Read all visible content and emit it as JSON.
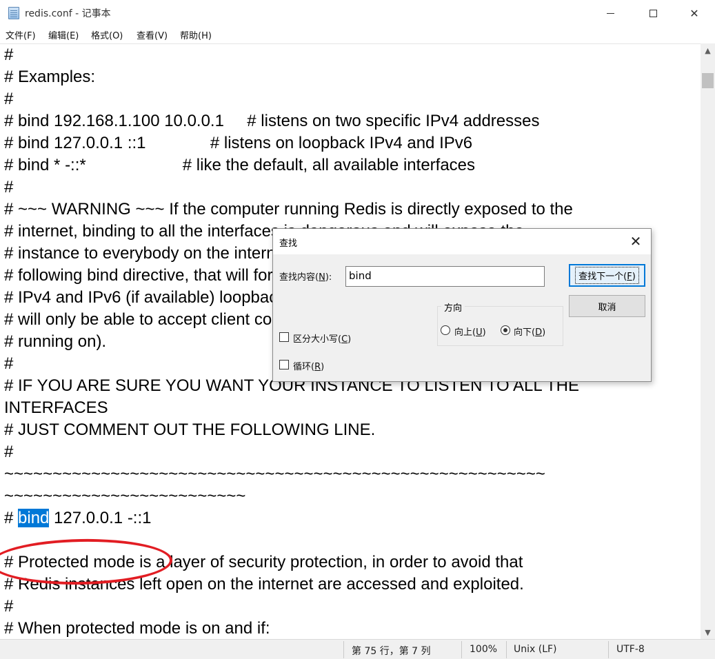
{
  "window": {
    "title": "redis.conf - 记事本",
    "minimize_icon": "minimize-icon",
    "maximize_icon": "maximize-icon",
    "close_label": "✕"
  },
  "menu": [
    {
      "label": "文件(F)"
    },
    {
      "label": "编辑(E)"
    },
    {
      "label": "格式(O)"
    },
    {
      "label": "查看(V)"
    },
    {
      "label": "帮助(H)"
    }
  ],
  "editor": {
    "lines": [
      "#",
      "# Examples:",
      "#",
      "# bind 192.168.1.100 10.0.0.1     # listens on two specific IPv4 addresses",
      "# bind 127.0.0.1 ::1              # listens on loopback IPv4 and IPv6",
      "# bind * -::*                     # like the default, all available interfaces",
      "#",
      "# ~~~ WARNING ~~~ If the computer running Redis is directly exposed to the",
      "# internet, binding to all the interfaces is dangerous and will expose the",
      "# instance to everybody on the internet. So by default we uncomment the",
      "# following bind directive, that will force Redis to listen only on the",
      "# IPv4 and IPv6 (if available) loopback interface addresses (this means Redis",
      "# will only be able to accept client connections from the same host that it is",
      "# running on).",
      "#",
      "# IF YOU ARE SURE YOU WANT YOUR INSTANCE TO LISTEN TO ALL THE",
      "INTERFACES",
      "# JUST COMMENT OUT THE FOLLOWING LINE.",
      "#",
      "~~~~~~~~~~~~~~~~~~~~~~~~~~~~~~~~~~~~~~~~~~~~~~~~~~~~~~~~",
      "~~~~~~~~~~~~~~~~~~~~~~~~~",
      "",
      "",
      "# Protected mode is a layer of security protection, in order to avoid that",
      "# Redis instances left open on the internet are accessed and exploited.",
      "#",
      "# When protected mode is on and if:"
    ],
    "bind_line": {
      "prefix": "# ",
      "selected": "bind",
      "suffix": " 127.0.0.1 -::1"
    }
  },
  "find_dialog": {
    "title": "查找",
    "find_label": "查找内容(N):",
    "find_label_main": "查找内容(",
    "find_label_key": "N",
    "find_label_end": "):",
    "find_value": "bind",
    "find_next_label_main": "查找下一个(",
    "find_next_key": "F",
    "find_next_end": ")",
    "cancel_label": "取消",
    "direction_title": "方向",
    "up_label_main": "向上(",
    "up_key": "U",
    "up_end": ")",
    "down_label_main": "向下(",
    "down_key": "D",
    "down_end": ")",
    "direction_selected": "down",
    "match_case_main": "区分大小写(",
    "match_case_key": "C",
    "match_case_end": ")",
    "wrap_main": "循环(",
    "wrap_key": "R",
    "wrap_end": ")",
    "match_case_checked": false,
    "wrap_checked": false
  },
  "statusbar": {
    "position": "第 75 行，第 7 列",
    "zoom": "100%",
    "line_ending": "Unix (LF)",
    "encoding": "UTF-8"
  },
  "annotation": {
    "color": "#e21d23"
  }
}
